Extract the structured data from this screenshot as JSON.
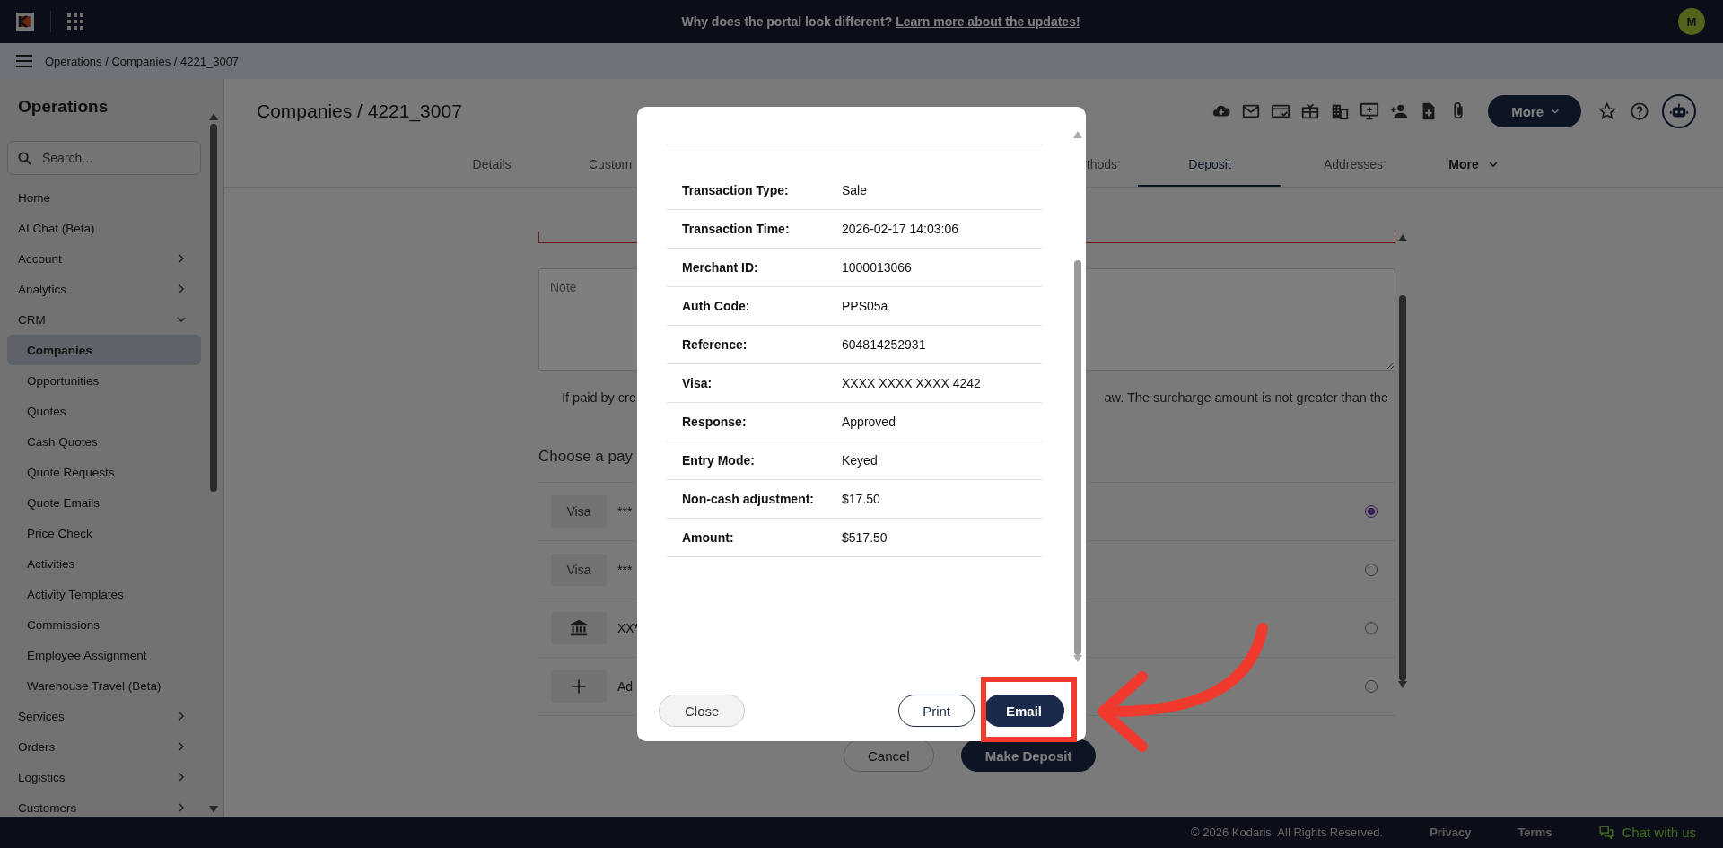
{
  "top_bar": {
    "banner_text": "Why does the portal look different?",
    "banner_link": "Learn more about the updates!",
    "avatar": "M"
  },
  "breadcrumb": "Operations / Companies / 4221_3007",
  "sidebar": {
    "title": "Operations",
    "search_placeholder": "Search...",
    "items": [
      {
        "label": "Home",
        "selected": false
      },
      {
        "label": "AI Chat (Beta)",
        "selected": false
      },
      {
        "label": "Account",
        "selected": false,
        "expanded": false
      },
      {
        "label": "Analytics",
        "selected": false,
        "expanded": false
      },
      {
        "label": "CRM",
        "selected": false,
        "expanded": true,
        "children": [
          {
            "label": "Companies",
            "selected": true
          },
          {
            "label": "Opportunities",
            "selected": false
          },
          {
            "label": "Quotes",
            "selected": false
          },
          {
            "label": "Cash Quotes",
            "selected": false
          },
          {
            "label": "Quote Requests",
            "selected": false
          },
          {
            "label": "Quote Emails",
            "selected": false
          },
          {
            "label": "Price Check",
            "selected": false
          },
          {
            "label": "Activities",
            "selected": false
          },
          {
            "label": "Activity Templates",
            "selected": false
          },
          {
            "label": "Commissions",
            "selected": false
          },
          {
            "label": "Employee Assignment",
            "selected": false
          },
          {
            "label": "Warehouse Travel (Beta)",
            "selected": false
          }
        ]
      },
      {
        "label": "Services",
        "selected": false,
        "expanded": false
      },
      {
        "label": "Orders",
        "selected": false,
        "expanded": false
      },
      {
        "label": "Logistics",
        "selected": false,
        "expanded": false
      },
      {
        "label": "Customers",
        "selected": false,
        "expanded": false
      }
    ]
  },
  "page": {
    "title": "Companies / 4221_3007",
    "more_button": "More"
  },
  "tabs": [
    {
      "label": "Details",
      "kind": "tab",
      "selected": false
    },
    {
      "label": "Custom",
      "kind": "partial_start",
      "selected": false
    },
    {
      "label": "thods",
      "kind": "partial_end",
      "selected": false
    },
    {
      "label": "Deposit",
      "kind": "tab",
      "selected": true
    },
    {
      "label": "Addresses",
      "kind": "tab",
      "selected": false
    },
    {
      "label": "More",
      "kind": "dropdown",
      "selected": false
    }
  ],
  "deposit": {
    "note_placeholder": "Note",
    "surcharge_text_start": "If paid by cre",
    "surcharge_text_end": "aw. The surcharge amount is not greater than the",
    "payment_heading": "Choose a pay",
    "payment_methods": [
      {
        "kind": "card",
        "label": "Visa",
        "mask": "***",
        "selected": true
      },
      {
        "kind": "card",
        "label": "Visa",
        "mask": "***",
        "selected": false
      },
      {
        "kind": "bank",
        "mask": "XX*",
        "selected": false
      },
      {
        "kind": "add",
        "mask": "Ad",
        "selected": false
      }
    ],
    "buttons": [
      "Cancel",
      "Make Deposit"
    ]
  },
  "receipt_dialog": {
    "rows": [
      {
        "label": "Transaction Type:",
        "value": "Sale"
      },
      {
        "label": "Transaction Time:",
        "value": "2026-02-17 14:03:06"
      },
      {
        "label": "Merchant ID:",
        "value": "1000013066"
      },
      {
        "label": "Auth Code:",
        "value": "PPS05a"
      },
      {
        "label": "Reference:",
        "value": "604814252931"
      },
      {
        "label": "Visa:",
        "value": "XXXX XXXX XXXX 4242"
      },
      {
        "label": "Response:",
        "value": "Approved"
      },
      {
        "label": "Entry Mode:",
        "value": "Keyed"
      },
      {
        "label": "Non-cash adjustment:",
        "value": "$17.50"
      },
      {
        "label": "Amount:",
        "value": "$517.50"
      }
    ],
    "buttons": [
      {
        "label": "Close",
        "kind": "secondary"
      },
      {
        "label": "Print",
        "kind": "outline"
      },
      {
        "label": "Email",
        "kind": "primary"
      }
    ]
  },
  "footer": {
    "copyright": "© 2026 Kodaris. All Rights Reserved.",
    "links": [
      "Privacy",
      "Terms"
    ],
    "chat": "Chat with us"
  }
}
